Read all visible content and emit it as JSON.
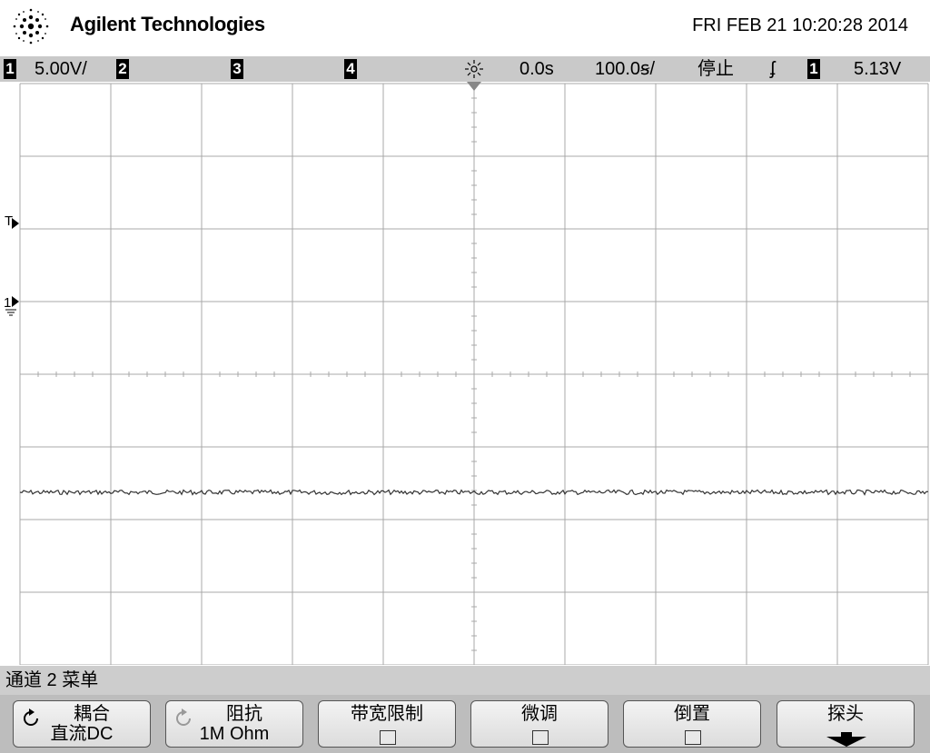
{
  "header": {
    "brand": "Agilent Technologies",
    "datetime": "FRI FEB 21 10:20:28 2014"
  },
  "status_bar": {
    "ch1_number": "1",
    "ch1_scale": "5.00V/",
    "ch2_number": "2",
    "ch3_number": "3",
    "ch4_number": "4",
    "time_delay": "0.0s",
    "time_scale": "100.0ꞩ/",
    "run_state": "停止",
    "trigger_slope_symbol": "ʄ",
    "trigger_source": "1",
    "trigger_level": "5.13V"
  },
  "markers": {
    "trigger_level_marker": "T",
    "ch1_ground_marker": "1"
  },
  "menu": {
    "title": "通道 2  菜单",
    "softkeys": {
      "coupling_label": "耦合",
      "coupling_value": "直流DC",
      "impedance_label": "阻抗",
      "impedance_value": "1M Ohm",
      "bw_limit_label": "带宽限制",
      "vernier_label": "微调",
      "invert_label": "倒置",
      "probe_label": "探头"
    }
  },
  "icons": [
    "agilent-spark-logo",
    "acquisition-sun-icon",
    "trigger-position-arrow-icon",
    "rotate-knob-icon",
    "down-arrow-icon",
    "checkbox-icon"
  ],
  "colors": {
    "status_bar_bg": "#c9c9c9",
    "graticule_line": "#a8a8a8",
    "trace": "#333333",
    "softkey_row_bg": "#bdbdbd"
  }
}
